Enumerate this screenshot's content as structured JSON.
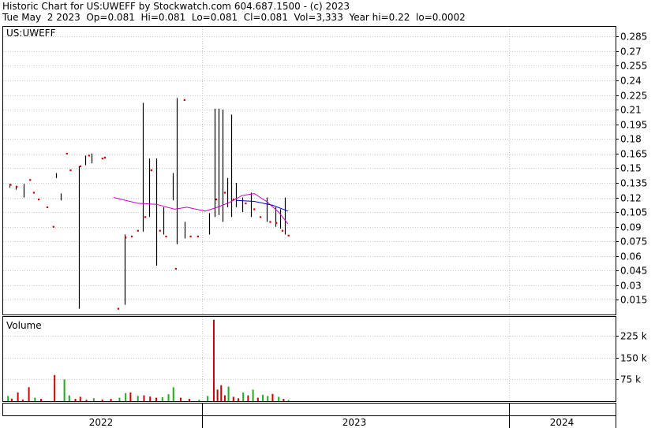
{
  "header": {
    "line1": "Historic Chart for US:UWEFF by Stockwatch.com 604.687.1500 - (c) 2023",
    "line2": "Tue May  2 2023  Op=0.081  Hi=0.081  Lo=0.081  Cl=0.081  Vol=3,333  Year hi=0.22  lo=0.0002"
  },
  "chart_data": [
    {
      "type": "ohlc",
      "title": "US:UWEFF",
      "xlabel": "",
      "ylabel": "",
      "ylim": [
        0,
        0.295
      ],
      "yticks": [
        "0.285",
        "0.27",
        "0.255",
        "0.24",
        "0.225",
        "0.21",
        "0.195",
        "0.18",
        "0.165",
        "0.15",
        "0.135",
        "0.12",
        "0.105",
        "0.09",
        "0.075",
        "0.06",
        "0.045",
        "0.03",
        "0.015"
      ],
      "grid": true,
      "x_labels": [
        "2022",
        "2023",
        "2024"
      ],
      "colors": {
        "bar": "#000000",
        "close_dot": "#cc0000",
        "ma_short": "#cc00cc",
        "ma_long": "#0000cc",
        "grid": "#c8c8c8"
      },
      "price_bars": [
        {
          "t": 0.01,
          "lo": 0.13,
          "hi": 0.134
        },
        {
          "t": 0.02,
          "lo": 0.128,
          "hi": 0.132
        },
        {
          "t": 0.034,
          "lo": 0.12,
          "hi": 0.134
        },
        {
          "t": 0.086,
          "lo": 0.14,
          "hi": 0.145
        },
        {
          "t": 0.094,
          "lo": 0.117,
          "hi": 0.124
        },
        {
          "t": 0.124,
          "lo": 0.006,
          "hi": 0.152
        },
        {
          "t": 0.134,
          "lo": 0.153,
          "hi": 0.163
        },
        {
          "t": 0.144,
          "lo": 0.155,
          "hi": 0.165
        },
        {
          "t": 0.198,
          "lo": 0.01,
          "hi": 0.082
        },
        {
          "t": 0.228,
          "lo": 0.085,
          "hi": 0.217
        },
        {
          "t": 0.238,
          "lo": 0.1,
          "hi": 0.16
        },
        {
          "t": 0.25,
          "lo": 0.05,
          "hi": 0.16
        },
        {
          "t": 0.262,
          "lo": 0.082,
          "hi": 0.11
        },
        {
          "t": 0.277,
          "lo": 0.117,
          "hi": 0.145
        },
        {
          "t": 0.284,
          "lo": 0.072,
          "hi": 0.222
        },
        {
          "t": 0.296,
          "lo": 0.078,
          "hi": 0.095
        },
        {
          "t": 0.336,
          "lo": 0.082,
          "hi": 0.104
        },
        {
          "t": 0.346,
          "lo": 0.1,
          "hi": 0.211
        },
        {
          "t": 0.352,
          "lo": 0.102,
          "hi": 0.211
        },
        {
          "t": 0.358,
          "lo": 0.095,
          "hi": 0.21
        },
        {
          "t": 0.366,
          "lo": 0.11,
          "hi": 0.14
        },
        {
          "t": 0.372,
          "lo": 0.1,
          "hi": 0.205
        },
        {
          "t": 0.38,
          "lo": 0.11,
          "hi": 0.135
        },
        {
          "t": 0.39,
          "lo": 0.105,
          "hi": 0.12
        },
        {
          "t": 0.404,
          "lo": 0.1,
          "hi": 0.125
        },
        {
          "t": 0.43,
          "lo": 0.095,
          "hi": 0.12
        },
        {
          "t": 0.444,
          "lo": 0.09,
          "hi": 0.11
        },
        {
          "t": 0.452,
          "lo": 0.088,
          "hi": 0.108
        },
        {
          "t": 0.46,
          "lo": 0.082,
          "hi": 0.12
        }
      ],
      "close_points": [
        {
          "t": 0.012,
          "v": 0.133
        },
        {
          "t": 0.022,
          "v": 0.131
        },
        {
          "t": 0.044,
          "v": 0.138
        },
        {
          "t": 0.05,
          "v": 0.125
        },
        {
          "t": 0.058,
          "v": 0.118
        },
        {
          "t": 0.072,
          "v": 0.11
        },
        {
          "t": 0.082,
          "v": 0.09
        },
        {
          "t": 0.104,
          "v": 0.165
        },
        {
          "t": 0.11,
          "v": 0.148
        },
        {
          "t": 0.126,
          "v": 0.152
        },
        {
          "t": 0.14,
          "v": 0.163
        },
        {
          "t": 0.162,
          "v": 0.16
        },
        {
          "t": 0.166,
          "v": 0.161
        },
        {
          "t": 0.188,
          "v": 0.006
        },
        {
          "t": 0.2,
          "v": 0.079
        },
        {
          "t": 0.21,
          "v": 0.08
        },
        {
          "t": 0.22,
          "v": 0.086
        },
        {
          "t": 0.232,
          "v": 0.1
        },
        {
          "t": 0.242,
          "v": 0.148
        },
        {
          "t": 0.256,
          "v": 0.086
        },
        {
          "t": 0.266,
          "v": 0.08
        },
        {
          "t": 0.282,
          "v": 0.047
        },
        {
          "t": 0.296,
          "v": 0.22
        },
        {
          "t": 0.306,
          "v": 0.08
        },
        {
          "t": 0.318,
          "v": 0.08
        },
        {
          "t": 0.348,
          "v": 0.118
        },
        {
          "t": 0.362,
          "v": 0.125
        },
        {
          "t": 0.376,
          "v": 0.118
        },
        {
          "t": 0.396,
          "v": 0.114
        },
        {
          "t": 0.41,
          "v": 0.108
        },
        {
          "t": 0.42,
          "v": 0.1
        },
        {
          "t": 0.436,
          "v": 0.095
        },
        {
          "t": 0.446,
          "v": 0.094
        },
        {
          "t": 0.456,
          "v": 0.086
        },
        {
          "t": 0.466,
          "v": 0.081
        }
      ],
      "ma_short": [
        {
          "t": 0.18,
          "v": 0.12
        },
        {
          "t": 0.22,
          "v": 0.114
        },
        {
          "t": 0.25,
          "v": 0.113
        },
        {
          "t": 0.28,
          "v": 0.108
        },
        {
          "t": 0.3,
          "v": 0.11
        },
        {
          "t": 0.33,
          "v": 0.106
        },
        {
          "t": 0.35,
          "v": 0.11
        },
        {
          "t": 0.37,
          "v": 0.115
        },
        {
          "t": 0.39,
          "v": 0.122
        },
        {
          "t": 0.41,
          "v": 0.124
        },
        {
          "t": 0.43,
          "v": 0.116
        },
        {
          "t": 0.45,
          "v": 0.105
        },
        {
          "t": 0.465,
          "v": 0.093
        }
      ],
      "ma_long": [
        {
          "t": 0.38,
          "v": 0.117
        },
        {
          "t": 0.41,
          "v": 0.116
        },
        {
          "t": 0.44,
          "v": 0.112
        },
        {
          "t": 0.465,
          "v": 0.106
        }
      ]
    },
    {
      "type": "bar",
      "title": "Volume",
      "xlabel": "",
      "ylabel": "",
      "ylim": [
        0,
        290000
      ],
      "yticks": [
        75000,
        150000,
        225000
      ],
      "ytick_labels": [
        "75 k",
        "150 k",
        "225 k"
      ],
      "bars": [
        {
          "t": 0.008,
          "v": 18000,
          "up": true
        },
        {
          "t": 0.014,
          "v": 9000,
          "up": false
        },
        {
          "t": 0.024,
          "v": 30000,
          "up": false
        },
        {
          "t": 0.032,
          "v": 6000,
          "up": false
        },
        {
          "t": 0.042,
          "v": 48000,
          "up": false
        },
        {
          "t": 0.052,
          "v": 12000,
          "up": true
        },
        {
          "t": 0.062,
          "v": 8000,
          "up": false
        },
        {
          "t": 0.084,
          "v": 90000,
          "up": false
        },
        {
          "t": 0.1,
          "v": 75000,
          "up": true
        },
        {
          "t": 0.108,
          "v": 20000,
          "up": true
        },
        {
          "t": 0.118,
          "v": 8000,
          "up": false
        },
        {
          "t": 0.126,
          "v": 15000,
          "up": false
        },
        {
          "t": 0.136,
          "v": 5000,
          "up": false
        },
        {
          "t": 0.148,
          "v": 10000,
          "up": true
        },
        {
          "t": 0.162,
          "v": 6000,
          "up": false
        },
        {
          "t": 0.176,
          "v": 8000,
          "up": false
        },
        {
          "t": 0.19,
          "v": 12000,
          "up": true
        },
        {
          "t": 0.2,
          "v": 28000,
          "up": true
        },
        {
          "t": 0.208,
          "v": 30000,
          "up": false
        },
        {
          "t": 0.22,
          "v": 18000,
          "up": true
        },
        {
          "t": 0.23,
          "v": 20000,
          "up": false
        },
        {
          "t": 0.24,
          "v": 16000,
          "up": false
        },
        {
          "t": 0.25,
          "v": 12000,
          "up": false
        },
        {
          "t": 0.26,
          "v": 14000,
          "up": true
        },
        {
          "t": 0.27,
          "v": 24000,
          "up": true
        },
        {
          "t": 0.278,
          "v": 48000,
          "up": true
        },
        {
          "t": 0.29,
          "v": 12000,
          "up": false
        },
        {
          "t": 0.304,
          "v": 8000,
          "up": false
        },
        {
          "t": 0.32,
          "v": 5000,
          "up": true
        },
        {
          "t": 0.334,
          "v": 18000,
          "up": true
        },
        {
          "t": 0.344,
          "v": 280000,
          "up": false
        },
        {
          "t": 0.35,
          "v": 40000,
          "up": false
        },
        {
          "t": 0.356,
          "v": 55000,
          "up": false
        },
        {
          "t": 0.362,
          "v": 20000,
          "up": false
        },
        {
          "t": 0.368,
          "v": 50000,
          "up": true
        },
        {
          "t": 0.376,
          "v": 15000,
          "up": false
        },
        {
          "t": 0.384,
          "v": 10000,
          "up": false
        },
        {
          "t": 0.392,
          "v": 30000,
          "up": true
        },
        {
          "t": 0.4,
          "v": 20000,
          "up": false
        },
        {
          "t": 0.408,
          "v": 40000,
          "up": true
        },
        {
          "t": 0.416,
          "v": 12000,
          "up": false
        },
        {
          "t": 0.424,
          "v": 22000,
          "up": true
        },
        {
          "t": 0.432,
          "v": 18000,
          "up": true
        },
        {
          "t": 0.44,
          "v": 25000,
          "up": false
        },
        {
          "t": 0.45,
          "v": 15000,
          "up": true
        },
        {
          "t": 0.458,
          "v": 8000,
          "up": false
        },
        {
          "t": 0.466,
          "v": 4000,
          "up": true
        }
      ],
      "colors": {
        "up": "#22aa22",
        "down": "#cc0000"
      }
    }
  ]
}
